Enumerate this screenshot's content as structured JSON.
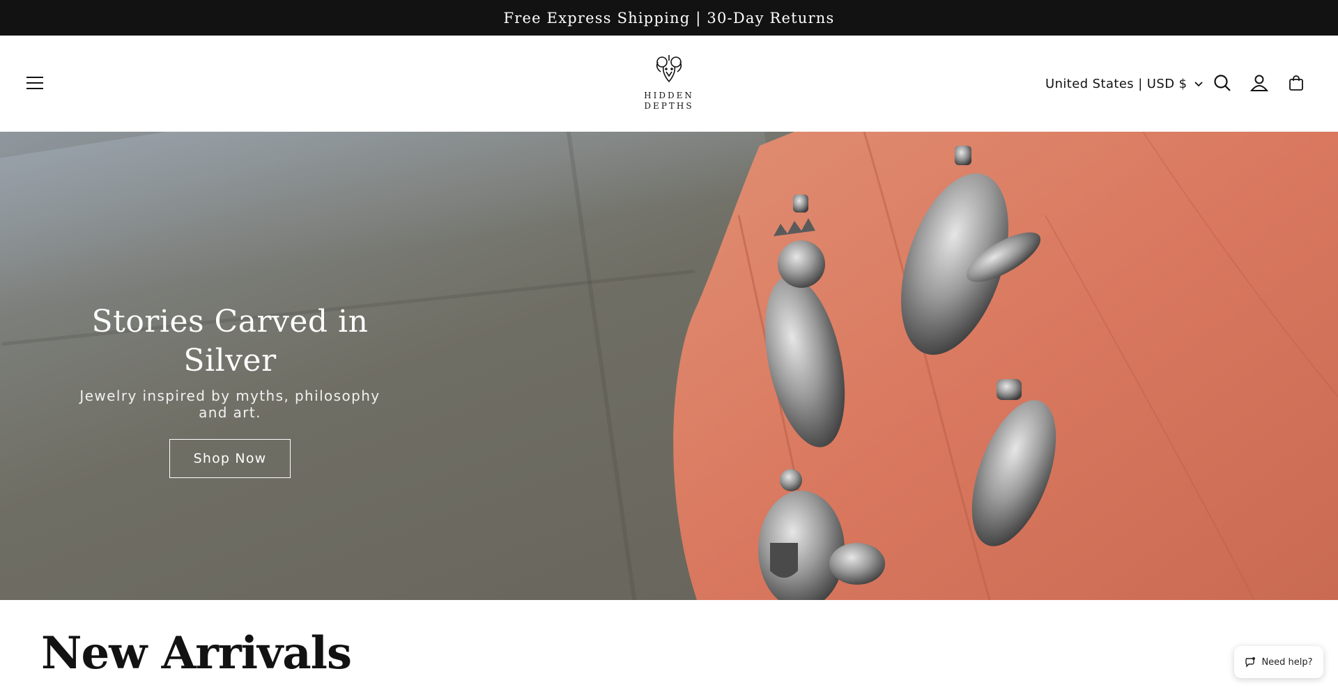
{
  "announcement": {
    "text": "Free Express Shipping | 30-Day Returns"
  },
  "header": {
    "menu_icon": "hamburger-menu-icon",
    "logo": {
      "line1": "HIDDEN",
      "line2": "DEPTHS",
      "emblem_icon": "ram-heads-emblem"
    },
    "locale_label": "United States | USD $",
    "icons": [
      "search-icon",
      "account-icon",
      "cart-icon"
    ]
  },
  "hero": {
    "title": "Stories Carved in Silver",
    "subtitle": "Jewelry inspired by myths, philosophy and art.",
    "cta_label": "Shop Now"
  },
  "section": {
    "title": "New Arrivals"
  },
  "help_widget": {
    "label": "Need help?",
    "icon": "chat-icon"
  },
  "colors": {
    "announcement_bg": "#121212",
    "text": "#121212",
    "hero_skin": "#d9785f"
  }
}
